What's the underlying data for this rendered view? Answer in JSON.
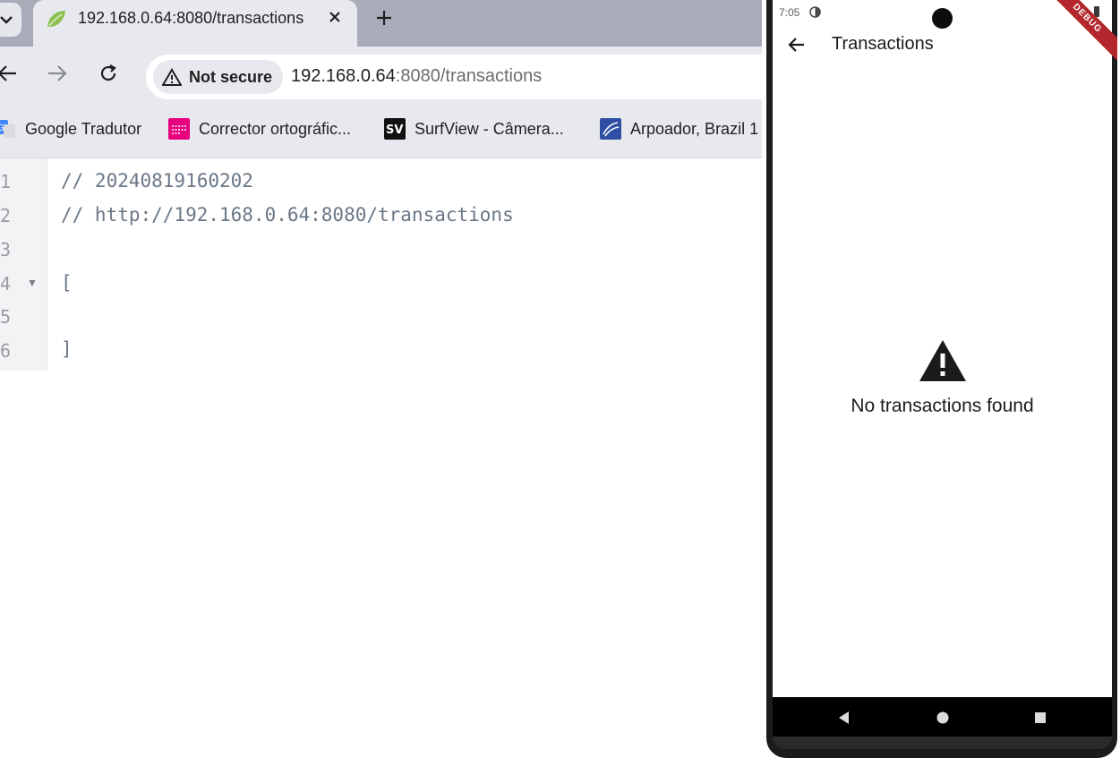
{
  "browser": {
    "tab": {
      "title": "192.168.0.64:8080/transactions"
    },
    "security_chip": "Not secure",
    "url": {
      "host": "192.168.0.64",
      "path": ":8080/transactions"
    },
    "bookmarks": [
      {
        "label": "Google Tradutor",
        "icon": "google-translate-icon"
      },
      {
        "label": "Corrector ortográfic...",
        "icon": "corrector-icon"
      },
      {
        "label": "SurfView - Câmera...",
        "icon": "surfview-icon"
      },
      {
        "label": "Arpoador, Brazil 1",
        "icon": "arpoador-icon"
      }
    ],
    "viewer": {
      "line_numbers": [
        "1",
        "2",
        "3",
        "4",
        "5",
        "6"
      ],
      "lines": [
        "// 20240819160202",
        "// http://192.168.0.64:8080/transactions",
        "",
        "[",
        "",
        "]"
      ]
    }
  },
  "phone": {
    "status_time": "7:05",
    "debug_banner": "DEBUG",
    "app_title": "Transactions",
    "empty_message": "No transactions found",
    "icons": {
      "back": "arrow-back-icon",
      "empty": "warning-icon",
      "nav": [
        "nav-back-icon",
        "nav-home-icon",
        "nav-recents-icon"
      ]
    }
  },
  "colors": {
    "browser_chrome": "#e8e9ee",
    "tabstrip": "#a9abb8",
    "code_text": "#6a7786",
    "debug_banner": "#b3262c"
  }
}
